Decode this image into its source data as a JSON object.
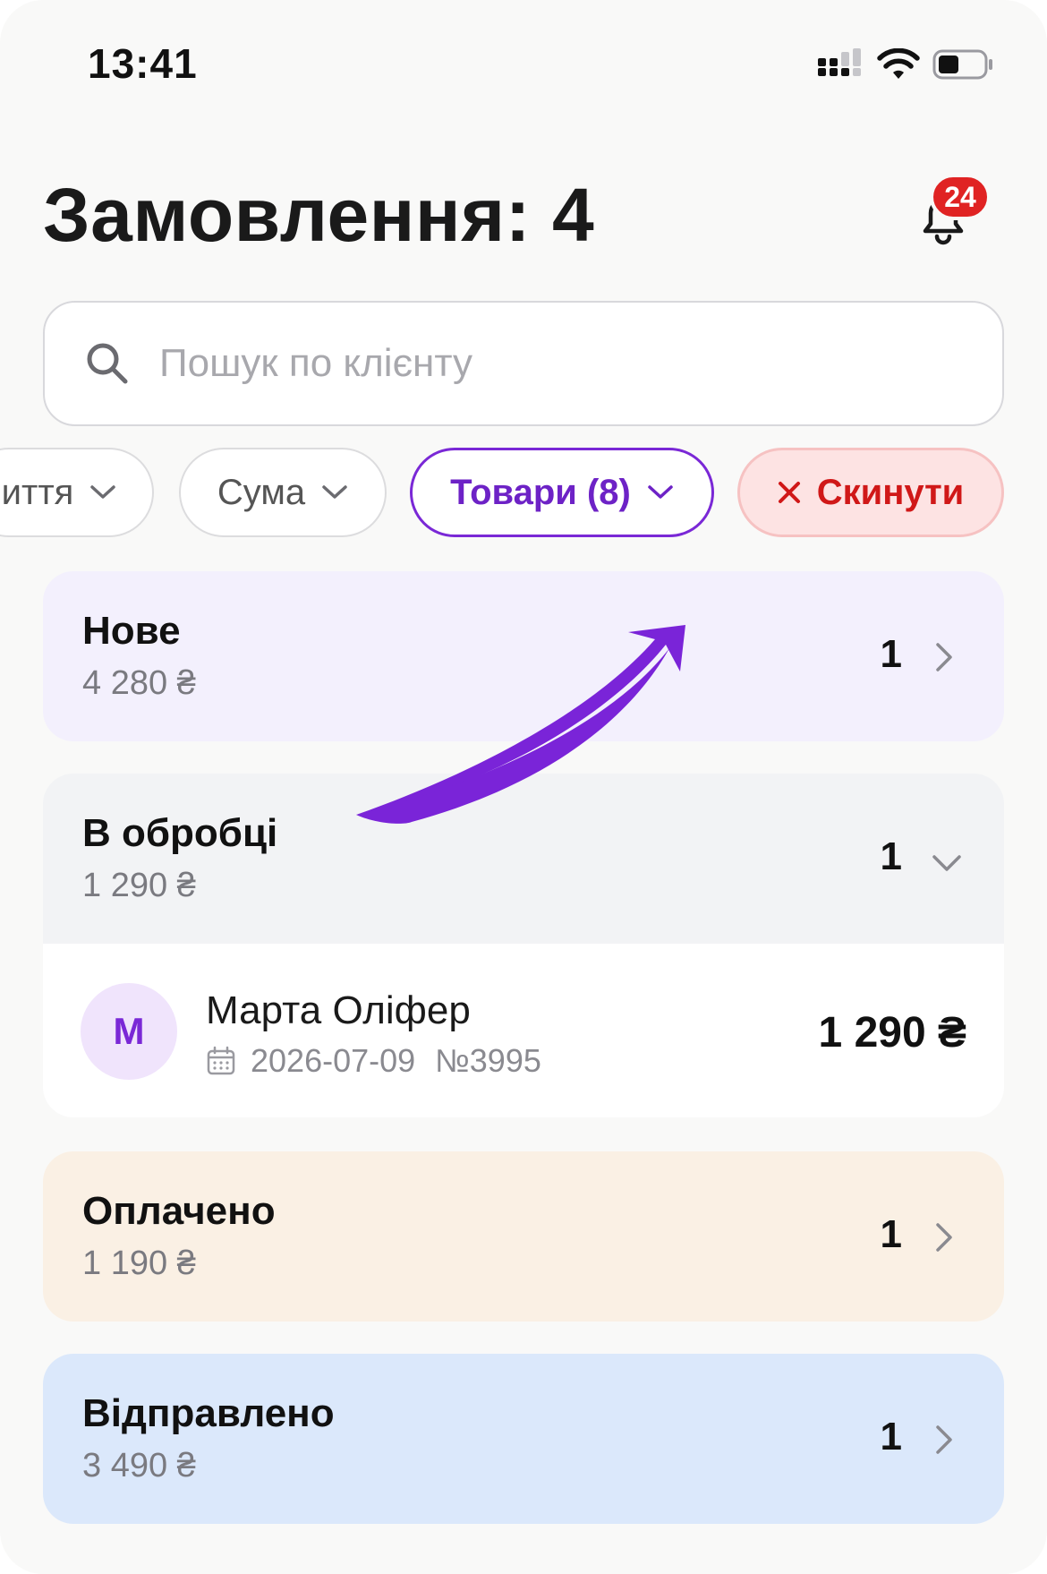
{
  "status_bar": {
    "time": "13:41"
  },
  "header": {
    "title": "Замовлення: 4",
    "notifications_badge": "24",
    "bell_icon": "bell-icon"
  },
  "search": {
    "placeholder": "Пошук по клієнту",
    "value": "",
    "icon": "search-icon"
  },
  "filters": [
    {
      "label": "иття",
      "selected": false
    },
    {
      "label": "Сума",
      "selected": false
    },
    {
      "label": "Товари (8)",
      "selected": true
    },
    {
      "label": "Скинути",
      "icon": "close-icon",
      "reset": true
    }
  ],
  "groups": [
    {
      "title": "Нове",
      "sum": "4 280 ₴",
      "count": "1",
      "expanded": false,
      "color": "#f3f0fd"
    },
    {
      "title": "В обробці",
      "sum": "1 290 ₴",
      "count": "1",
      "expanded": true,
      "color": "#f2f3f5",
      "orders": [
        {
          "avatar_letter": "М",
          "customer": "Марта Оліфер",
          "date": "2026-07-09",
          "number": "№3995",
          "amount": "1 290 ₴"
        }
      ]
    },
    {
      "title": "Оплачено",
      "sum": "1 190 ₴",
      "count": "1",
      "expanded": false,
      "color": "#faf0e4"
    },
    {
      "title": "Відправлено",
      "sum": "3 490 ₴",
      "count": "1",
      "expanded": false,
      "color": "#dbe8fb"
    }
  ],
  "colors": {
    "accent": "#7a28d6",
    "danger": "#d01818",
    "badge": "#e02323"
  }
}
